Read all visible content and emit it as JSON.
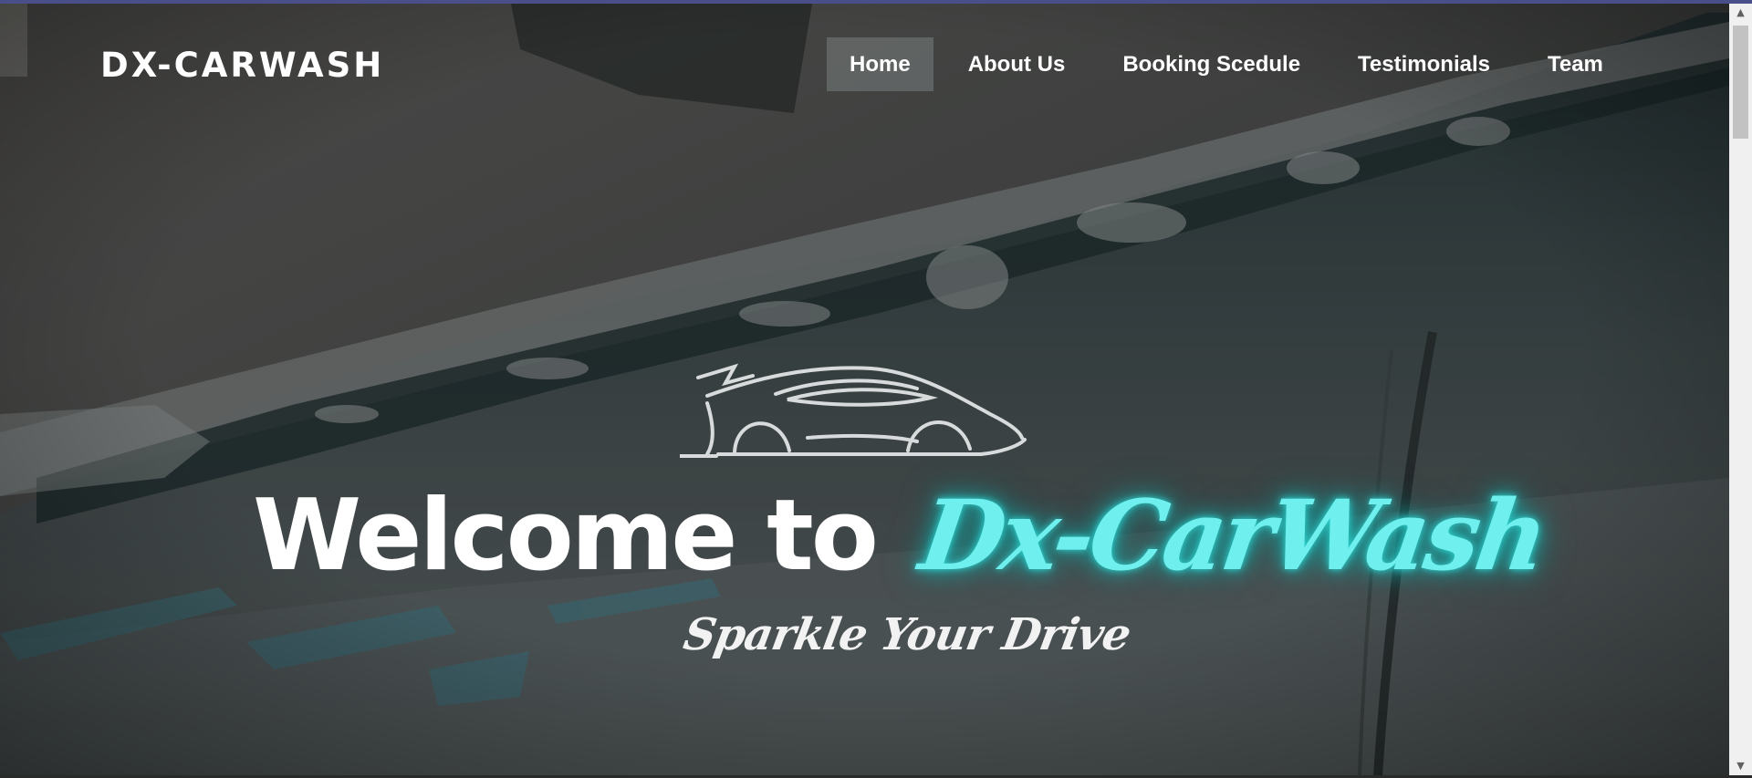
{
  "brand": {
    "name": "DX-CARWASH"
  },
  "nav": {
    "items": [
      {
        "label": "Home",
        "active": true
      },
      {
        "label": "About Us",
        "active": false
      },
      {
        "label": "Booking Scedule",
        "active": false
      },
      {
        "label": "Testimonials",
        "active": false
      },
      {
        "label": "Team",
        "active": false
      }
    ]
  },
  "hero": {
    "welcome": "Welcome to",
    "brand_script": "Dx-CarWash",
    "tagline": "Sparkle Your Drive"
  },
  "icons": {
    "car_logo": "sports-car-outline-icon",
    "scroll_up": "triangle-up-icon",
    "scroll_down": "triangle-down-icon"
  },
  "colors": {
    "accent_glow": "#6ff0ee",
    "nav_active_bg": "#6e7373",
    "text": "#ffffff"
  }
}
